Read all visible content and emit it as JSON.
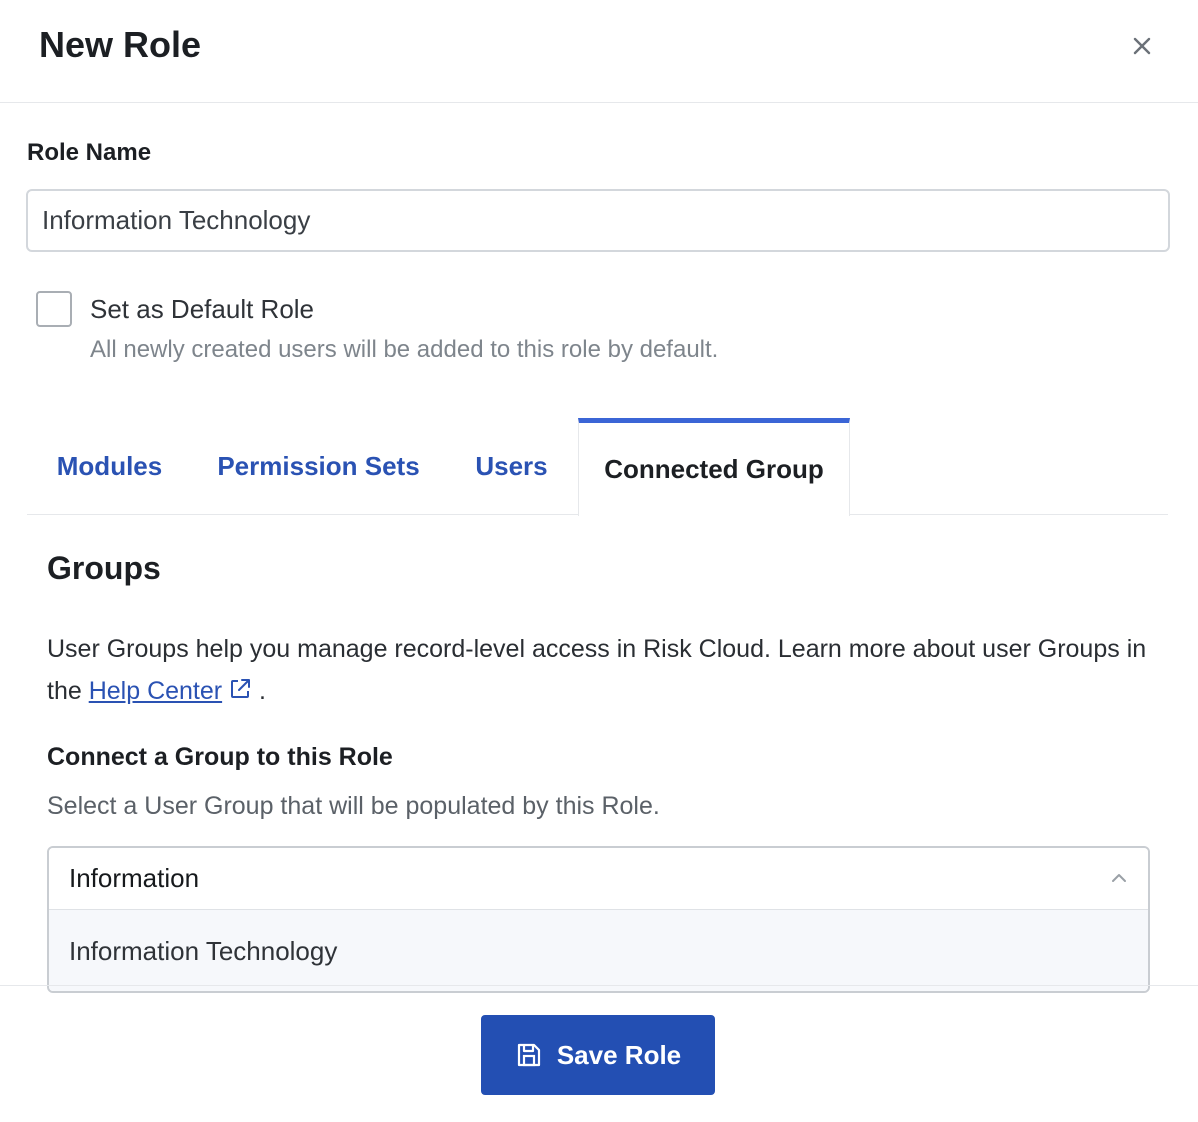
{
  "dialog": {
    "title": "New Role",
    "close_icon": "close-icon"
  },
  "role_name": {
    "label": "Role Name",
    "value": "Information Technology"
  },
  "default_role": {
    "checked": false,
    "label": "Set as Default Role",
    "help": "All newly created users will be added to this role by default."
  },
  "tabs": [
    {
      "label": "Modules",
      "active": false
    },
    {
      "label": "Permission Sets",
      "active": false
    },
    {
      "label": "Users",
      "active": false
    },
    {
      "label": "Connected Group",
      "active": true
    }
  ],
  "groups": {
    "title": "Groups",
    "description_before_link": "User Groups help you manage record-level access in Risk Cloud. Learn more about user Groups in the ",
    "link_text": "Help Center",
    "link_icon": "external-link-icon",
    "description_after_link": " .",
    "connect_title": "Connect a Group to this Role",
    "connect_help": "Select a User Group that will be populated by this Role.",
    "search_value": "Information",
    "chevron_icon": "chevron-up-icon",
    "options": [
      "Information Technology"
    ]
  },
  "footer": {
    "save_label": "Save Role",
    "save_icon": "save-icon"
  },
  "colors": {
    "accent": "#3b65d6",
    "link": "#2a52b3",
    "primary_button": "#234fb3"
  }
}
